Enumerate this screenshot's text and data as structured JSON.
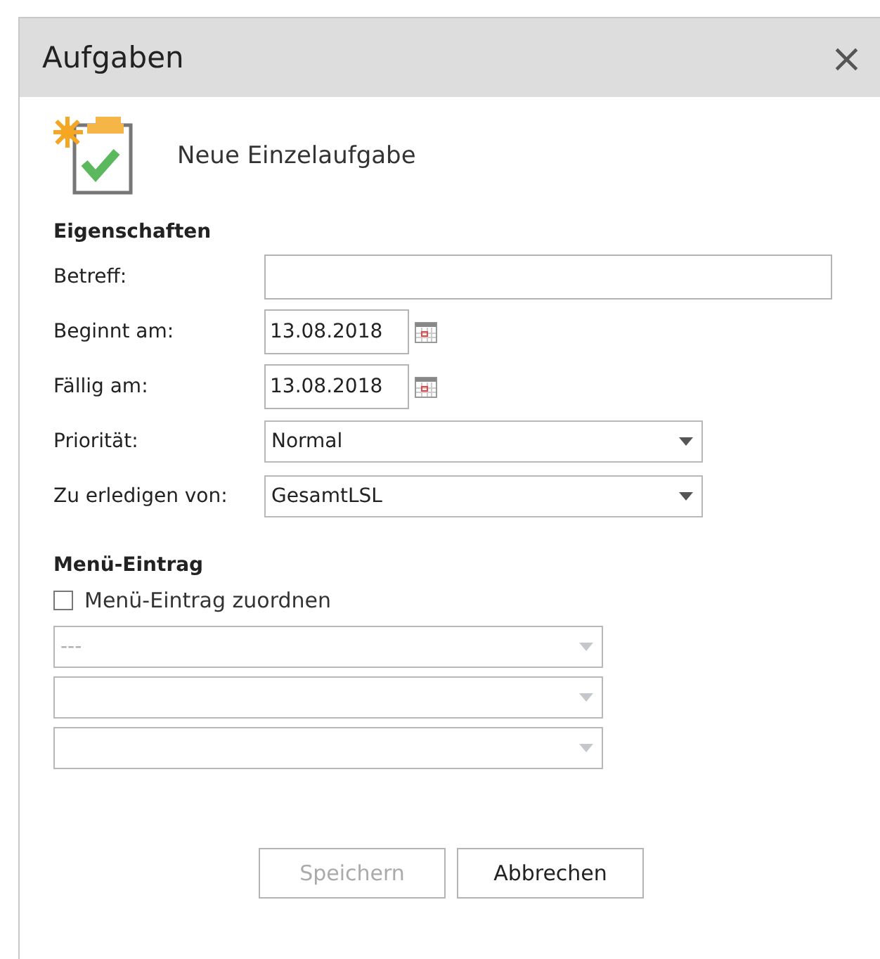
{
  "window": {
    "title": "Aufgaben",
    "close": "×"
  },
  "header": {
    "title": "Neue Einzelaufgabe"
  },
  "properties": {
    "heading": "Eigenschaften",
    "fields": [
      {
        "label": "Betreff:",
        "kind": "text"
      },
      {
        "label": "Beginnt am:",
        "kind": "date",
        "value": "13.08.2018"
      },
      {
        "label": "Fällig am:",
        "kind": "date",
        "value": "13.08.2018"
      },
      {
        "label": "Priorität:",
        "kind": "select",
        "value": "Normal"
      },
      {
        "label": "Zu erledigen von:",
        "kind": "select",
        "value": "GesamtLSL"
      }
    ]
  },
  "menu_entry": {
    "heading": "Menü-Eintrag",
    "checkbox": {
      "label": "Menü-Eintrag zuordnen",
      "checked": false
    },
    "dropdowns": [
      {
        "value": "---",
        "disabled": true
      },
      {
        "disabled": true
      },
      {
        "disabled": true
      }
    ]
  },
  "buttons": [
    {
      "label": "Speichern",
      "disabled": true
    },
    {
      "label": "Abbrechen",
      "disabled": false
    }
  ]
}
